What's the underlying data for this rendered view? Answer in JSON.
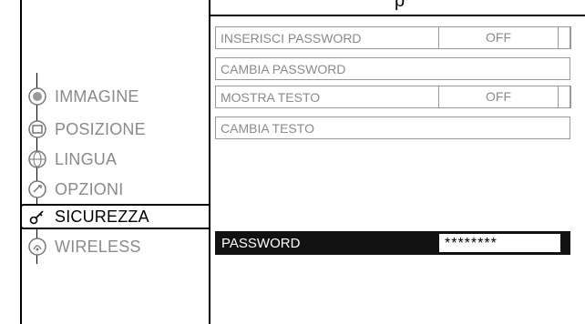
{
  "menu": {
    "items": [
      {
        "label": "IMMAGINE",
        "icon": "image-icon",
        "active": false
      },
      {
        "label": "POSIZIONE",
        "icon": "position-icon",
        "active": false
      },
      {
        "label": "LINGUA",
        "icon": "globe-icon",
        "active": false
      },
      {
        "label": "OPZIONI",
        "icon": "options-icon",
        "active": false
      },
      {
        "label": "SICUREZZA",
        "icon": "key-icon",
        "active": true
      },
      {
        "label": "WIRELESS",
        "icon": "wireless-icon",
        "active": false
      }
    ]
  },
  "security_panel": {
    "rows": [
      {
        "label": "INSERISCI PASSWORD",
        "value": "OFF"
      },
      {
        "label": "CAMBIA PASSWORD",
        "value": ""
      },
      {
        "label": "MOSTRA TESTO",
        "value": "OFF"
      },
      {
        "label": "CAMBIA TESTO",
        "value": ""
      }
    ],
    "password": {
      "label": "PASSWORD",
      "value": "********"
    }
  },
  "colors": {
    "text_inactive": "#8a8a8a",
    "text_active": "#000000",
    "password_bar": "#111111"
  }
}
